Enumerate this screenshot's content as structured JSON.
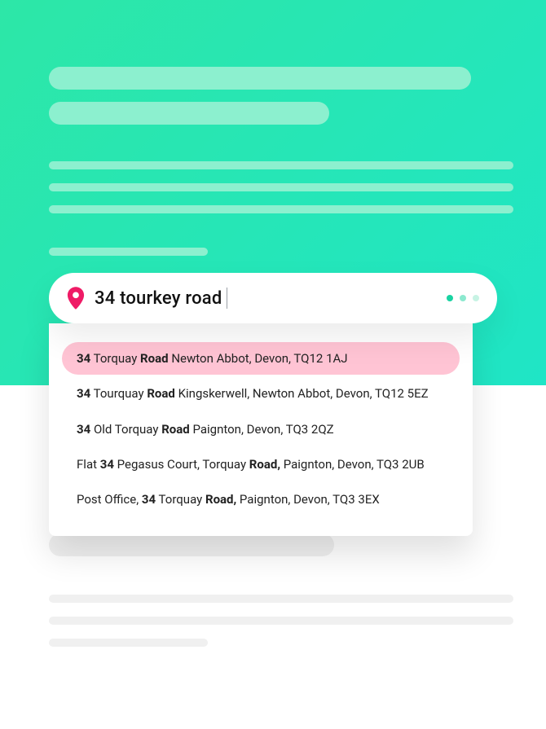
{
  "search": {
    "query": "34 tourkey road",
    "loading_dots": [
      "#19d3a2",
      "#8ce9cf",
      "#c7f3e4"
    ],
    "pin_color": "#ef1b66"
  },
  "suggestions": [
    {
      "selected": true,
      "segments": [
        {
          "t": "34",
          "b": true
        },
        {
          "t": " Torquay "
        },
        {
          "t": "Road",
          "b": true
        },
        {
          "t": " Newton Abbot, Devon, TQ12 1AJ"
        }
      ]
    },
    {
      "selected": false,
      "segments": [
        {
          "t": "34",
          "b": true
        },
        {
          "t": " Tourquay "
        },
        {
          "t": "Road",
          "b": true
        },
        {
          "t": " Kingskerwell, Newton Abbot, Devon, TQ12 5EZ"
        }
      ]
    },
    {
      "selected": false,
      "segments": [
        {
          "t": "34",
          "b": true
        },
        {
          "t": " Old Torquay "
        },
        {
          "t": "Road",
          "b": true
        },
        {
          "t": " Paignton, Devon, TQ3 2QZ"
        }
      ]
    },
    {
      "selected": false,
      "segments": [
        {
          "t": "Flat "
        },
        {
          "t": "34",
          "b": true
        },
        {
          "t": " Pegasus Court, Torquay "
        },
        {
          "t": "Road,",
          "b": true
        },
        {
          "t": " Paignton, Devon, TQ3 2UB"
        }
      ]
    },
    {
      "selected": false,
      "segments": [
        {
          "t": "Post Office, "
        },
        {
          "t": "34",
          "b": true
        },
        {
          "t": " Torquay "
        },
        {
          "t": "Road,",
          "b": true
        },
        {
          "t": " Paignton, Devon, TQ3 3EX"
        }
      ]
    }
  ]
}
